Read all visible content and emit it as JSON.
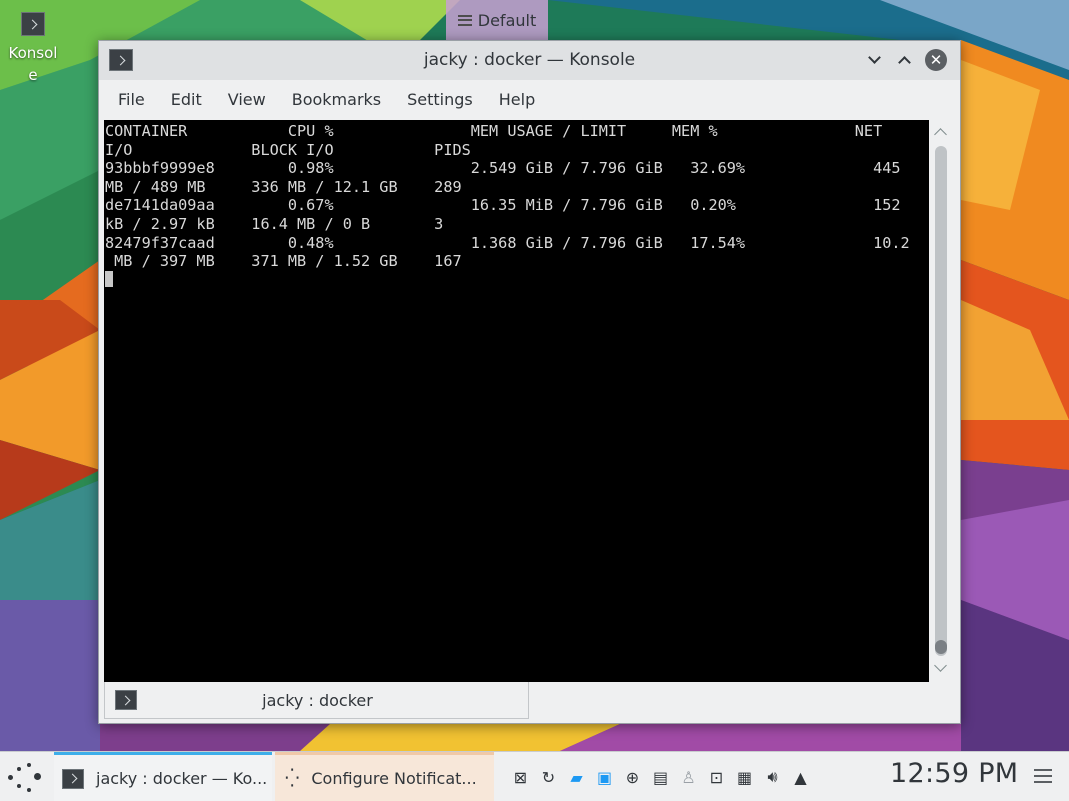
{
  "desktop": {
    "icon_label": "Konsole",
    "activity_label": "Default"
  },
  "window": {
    "title": "jacky : docker — Konsole",
    "menu": [
      "File",
      "Edit",
      "View",
      "Bookmarks",
      "Settings",
      "Help"
    ],
    "terminal_lines": [
      "CONTAINER           CPU %               MEM USAGE / LIMIT     MEM %               NET",
      "I/O             BLOCK I/O           PIDS",
      "93bbbf9999e8        0.98%               2.549 GiB / 7.796 GiB   32.69%              445",
      "MB / 489 MB     336 MB / 12.1 GB    289",
      "de7141da09aa        0.67%               16.35 MiB / 7.796 GiB   0.20%               152",
      "kB / 2.97 kB    16.4 MB / 0 B       3",
      "82479f37caad        0.48%               1.368 GiB / 7.796 GiB   17.54%              10.2",
      " MB / 397 MB    371 MB / 1.52 GB    167"
    ],
    "tab_title": "jacky : docker"
  },
  "taskbar": {
    "task1_label": "jacky : docker — Ko...",
    "task2_label": "Configure Notificat...",
    "clock": "12:59 PM"
  },
  "colors": {
    "accent": "#3daee9",
    "terminal_bg": "#000000",
    "terminal_fg": "#d9d9d9"
  }
}
